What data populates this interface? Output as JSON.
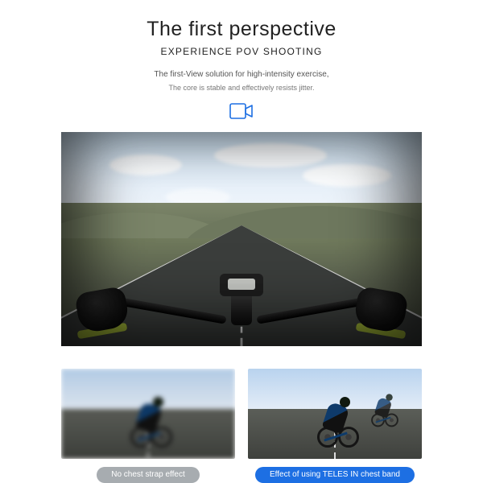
{
  "header": {
    "title": "The first perspective",
    "subtitle": "EXPERIENCE POV SHOOTING",
    "desc1": "The first-View solution for high-intensity exercise,",
    "desc2": "The core is stable and effectively resists jitter."
  },
  "icon": "video-camera-icon",
  "compare": {
    "left_label": "No chest strap effect",
    "right_label": "Effect of using TELES IN chest band"
  }
}
